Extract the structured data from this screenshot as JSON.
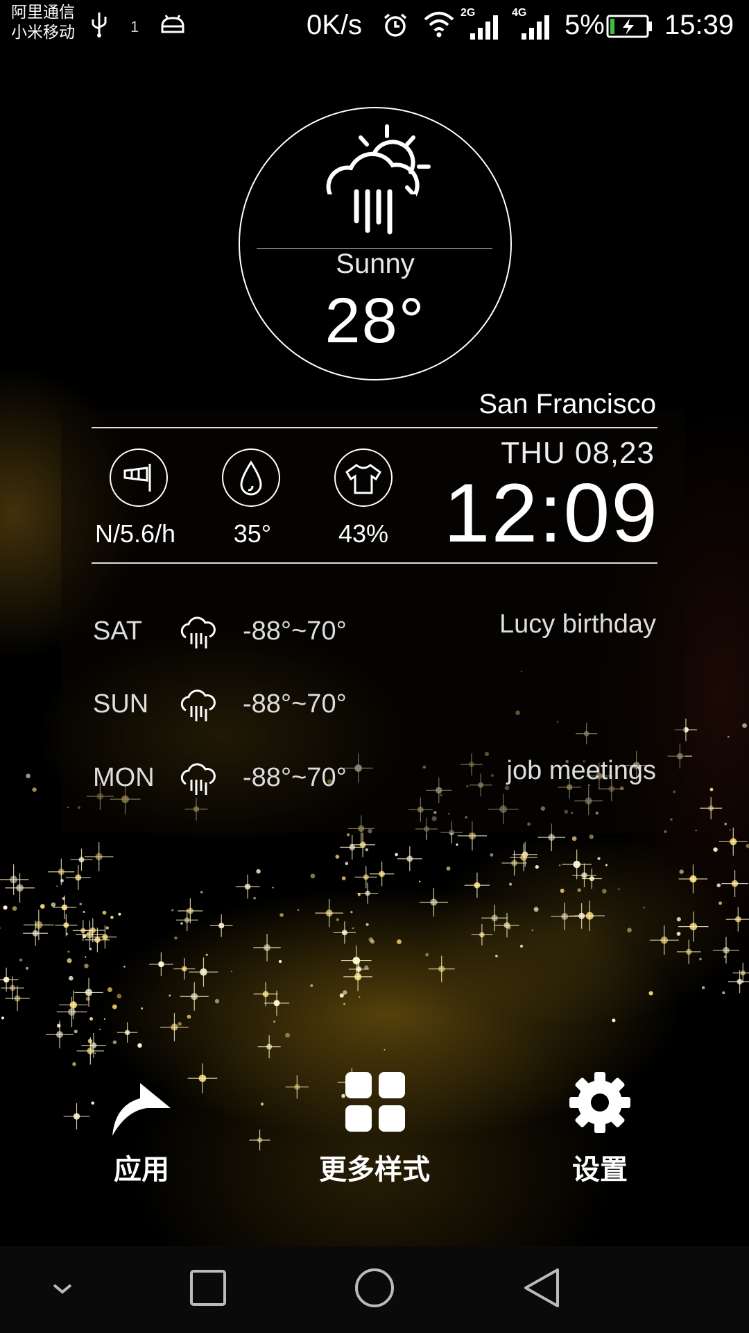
{
  "status_bar": {
    "carrier_1": "阿里通信",
    "carrier_2": "小米移动",
    "notification_count": "1",
    "net_speed": "0K/s",
    "signal_1_type": "2G",
    "signal_2_type": "4G",
    "battery_percent": "5%",
    "time": "15:39"
  },
  "weather": {
    "icon": "sun-cloud-rain-icon",
    "condition": "Sunny",
    "temperature": "28°",
    "city": "San Francisco"
  },
  "stats": {
    "wind": "N/5.6/h",
    "humidity": "35°",
    "clothing": "43%"
  },
  "datetime": {
    "date": "THU  08,23",
    "clock": "12:09"
  },
  "forecast": [
    {
      "day": "SAT",
      "icon": "cloud-rain-icon",
      "range": "-88°~70°",
      "event": "Lucy birthday"
    },
    {
      "day": "SUN",
      "icon": "cloud-rain-icon",
      "range": "-88°~70°",
      "event": ""
    },
    {
      "day": "MON",
      "icon": "cloud-rain-icon",
      "range": "-88°~70°",
      "event": "job meetings"
    }
  ],
  "shortcuts": {
    "apps_label": "应用",
    "styles_label": "更多样式",
    "settings_label": "设置"
  },
  "nav_bar": {
    "icons": [
      "chevron-down-icon",
      "recents-square-icon",
      "home-circle-icon",
      "back-triangle-icon"
    ]
  },
  "colors": {
    "background": "#000000",
    "glow": "#c9a43a",
    "text": "#ffffff"
  }
}
